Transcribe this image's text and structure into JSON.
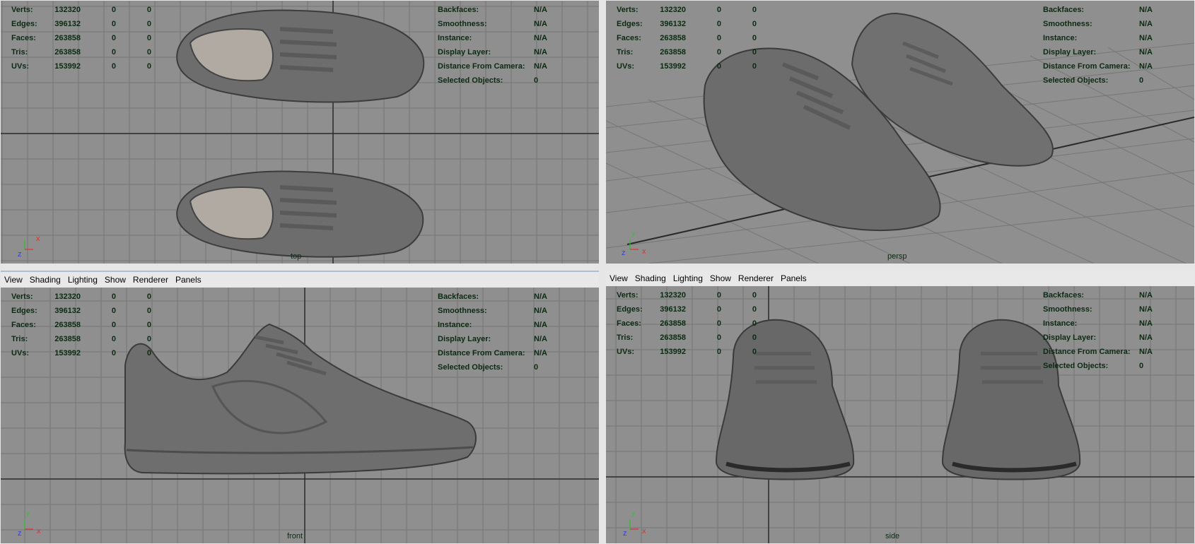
{
  "menu": [
    "View",
    "Shading",
    "Lighting",
    "Show",
    "Renderer",
    "Panels"
  ],
  "hud_left_rows": [
    {
      "label": "Verts:",
      "v1": "132320",
      "v2": "0",
      "v3": "0"
    },
    {
      "label": "Edges:",
      "v1": "396132",
      "v2": "0",
      "v3": "0"
    },
    {
      "label": "Faces:",
      "v1": "263858",
      "v2": "0",
      "v3": "0"
    },
    {
      "label": "Tris:",
      "v1": "263858",
      "v2": "0",
      "v3": "0"
    },
    {
      "label": "UVs:",
      "v1": "153992",
      "v2": "0",
      "v3": "0"
    }
  ],
  "hud_right_rows": [
    {
      "label": "Backfaces:",
      "value": "N/A"
    },
    {
      "label": "Smoothness:",
      "value": "N/A"
    },
    {
      "label": "Instance:",
      "value": "N/A"
    },
    {
      "label": "Display Layer:",
      "value": "N/A"
    },
    {
      "label": "Distance From Camera:",
      "value": "N/A"
    },
    {
      "label": "Selected Objects:",
      "value": "0"
    }
  ],
  "viewports": {
    "top": {
      "camera": "top"
    },
    "persp": {
      "camera": "persp"
    },
    "front": {
      "camera": "front"
    },
    "side": {
      "camera": "side"
    }
  },
  "axis_labels": {
    "x": "x",
    "y": "y",
    "z": "z"
  },
  "colors": {
    "viewport_bg": "#8f8f8f",
    "grid": "#767676",
    "grid_axis": "#2a2a2a",
    "hud_text": "#0c2a12",
    "model": "#6e6e6e",
    "axis_x": "#e03030",
    "axis_y": "#30c030",
    "axis_z": "#3040e0"
  },
  "icons": {
    "axis_indicator": "axis-gizmo-icon"
  }
}
